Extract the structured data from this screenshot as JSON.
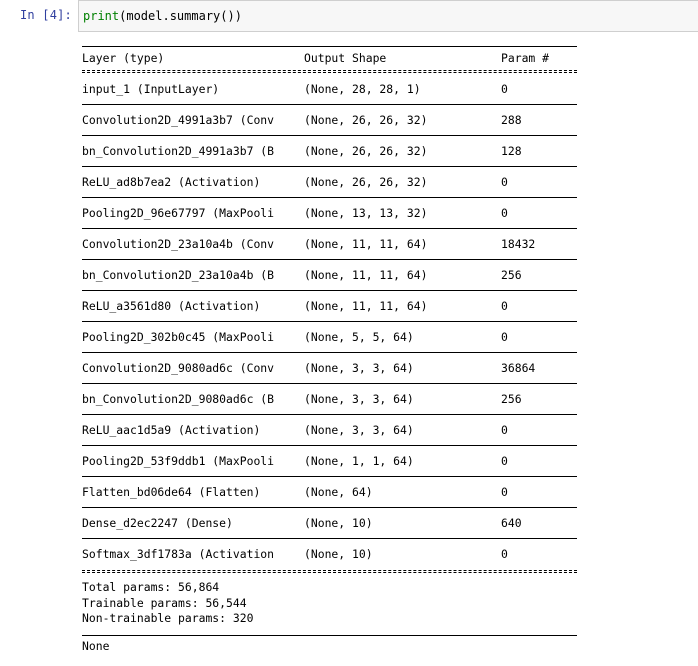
{
  "cell": {
    "prompt": "In [4]:",
    "code_func": "print",
    "code_rest": "(model.summary())"
  },
  "summary": {
    "headers": [
      "Layer (type)",
      "Output Shape",
      "Param #"
    ],
    "rows": [
      {
        "layer": "input_1 (InputLayer)",
        "shape": "(None, 28, 28, 1)",
        "params": "0"
      },
      {
        "layer": "Convolution2D_4991a3b7 (Conv",
        "shape": "(None, 26, 26, 32)",
        "params": "288"
      },
      {
        "layer": "bn_Convolution2D_4991a3b7 (B",
        "shape": "(None, 26, 26, 32)",
        "params": "128"
      },
      {
        "layer": "ReLU_ad8b7ea2 (Activation)",
        "shape": "(None, 26, 26, 32)",
        "params": "0"
      },
      {
        "layer": "Pooling2D_96e67797 (MaxPooli",
        "shape": "(None, 13, 13, 32)",
        "params": "0"
      },
      {
        "layer": "Convolution2D_23a10a4b (Conv",
        "shape": "(None, 11, 11, 64)",
        "params": "18432"
      },
      {
        "layer": "bn_Convolution2D_23a10a4b (B",
        "shape": "(None, 11, 11, 64)",
        "params": "256"
      },
      {
        "layer": "ReLU_a3561d80 (Activation)",
        "shape": "(None, 11, 11, 64)",
        "params": "0"
      },
      {
        "layer": "Pooling2D_302b0c45 (MaxPooli",
        "shape": "(None, 5, 5, 64)",
        "params": "0"
      },
      {
        "layer": "Convolution2D_9080ad6c (Conv",
        "shape": "(None, 3, 3, 64)",
        "params": "36864"
      },
      {
        "layer": "bn_Convolution2D_9080ad6c (B",
        "shape": "(None, 3, 3, 64)",
        "params": "256"
      },
      {
        "layer": "ReLU_aac1d5a9 (Activation)",
        "shape": "(None, 3, 3, 64)",
        "params": "0"
      },
      {
        "layer": "Pooling2D_53f9ddb1 (MaxPooli",
        "shape": "(None, 1, 1, 64)",
        "params": "0"
      },
      {
        "layer": "Flatten_bd06de64 (Flatten)",
        "shape": "(None, 64)",
        "params": "0"
      },
      {
        "layer": "Dense_d2ec2247 (Dense)",
        "shape": "(None, 10)",
        "params": "640"
      },
      {
        "layer": "Softmax_3df1783a (Activation",
        "shape": "(None, 10)",
        "params": "0"
      }
    ],
    "total": "Total params: 56,864",
    "trainable": "Trainable params: 56,544",
    "non_trainable": "Non-trainable params: 320",
    "result": "None"
  }
}
